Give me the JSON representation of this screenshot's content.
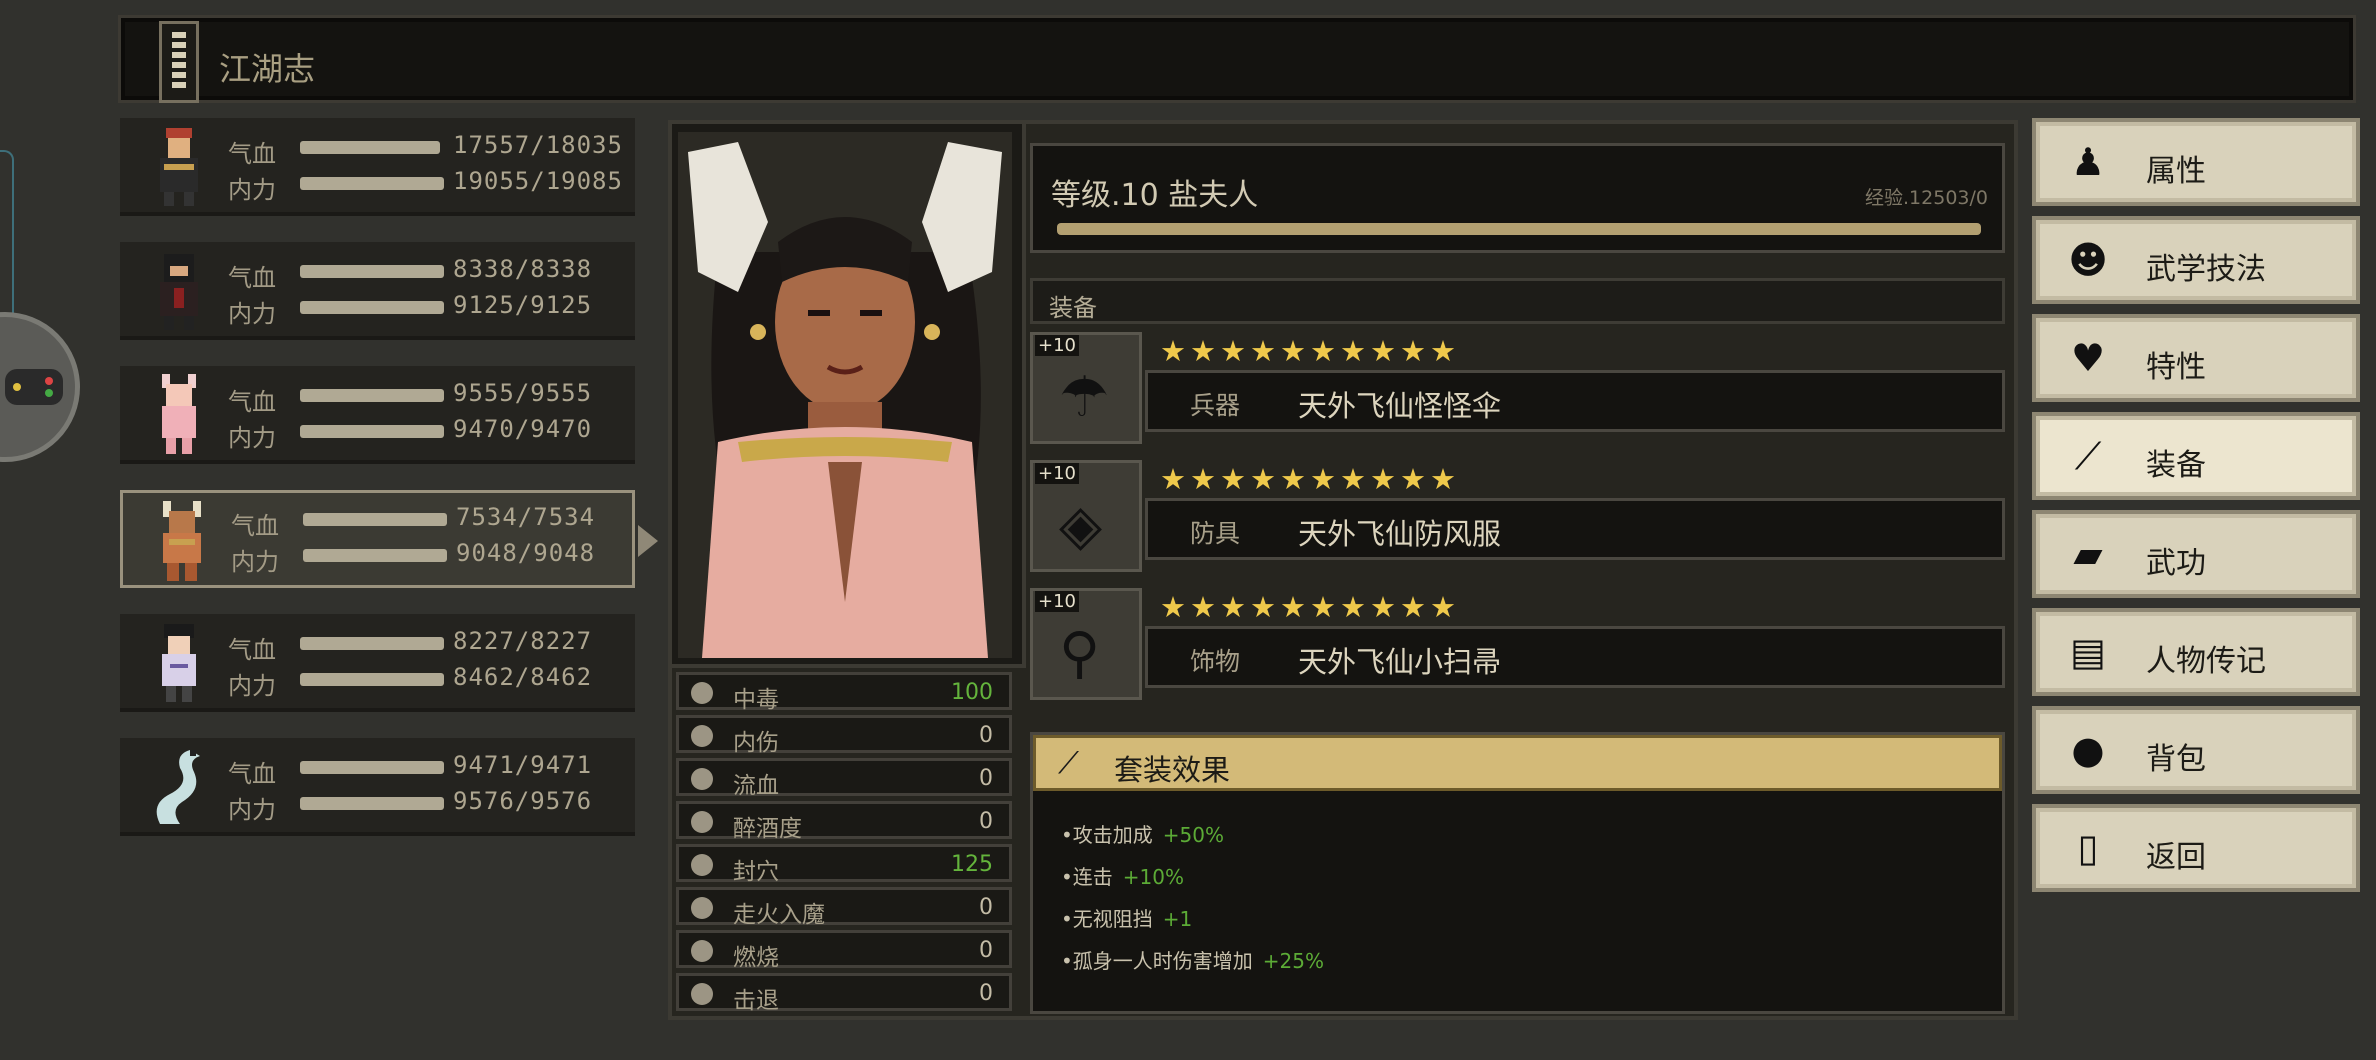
{
  "window": {
    "title": "江湖志"
  },
  "roster": [
    {
      "hp_label": "气血",
      "mp_label": "内力",
      "hp": "17557/18035",
      "mp": "19055/19085",
      "selected": false,
      "hp_fill": 0.97,
      "mp_fill": 1.0
    },
    {
      "hp_label": "气血",
      "mp_label": "内力",
      "hp": "8338/8338",
      "mp": "9125/9125",
      "selected": false,
      "hp_fill": 1.0,
      "mp_fill": 1.0
    },
    {
      "hp_label": "气血",
      "mp_label": "内力",
      "hp": "9555/9555",
      "mp": "9470/9470",
      "selected": false,
      "hp_fill": 1.0,
      "mp_fill": 1.0
    },
    {
      "hp_label": "气血",
      "mp_label": "内力",
      "hp": "7534/7534",
      "mp": "9048/9048",
      "selected": true,
      "hp_fill": 1.0,
      "mp_fill": 1.0
    },
    {
      "hp_label": "气血",
      "mp_label": "内力",
      "hp": "8227/8227",
      "mp": "8462/8462",
      "selected": false,
      "hp_fill": 1.0,
      "mp_fill": 1.0
    },
    {
      "hp_label": "气血",
      "mp_label": "内力",
      "hp": "9471/9471",
      "mp": "9576/9576",
      "selected": false,
      "hp_fill": 1.0,
      "mp_fill": 1.0
    }
  ],
  "character": {
    "level_line": "等级.10 盐夫人",
    "exp": "经验.12503/0"
  },
  "status": [
    {
      "label": "中毒",
      "value": "100",
      "highlight": true
    },
    {
      "label": "内伤",
      "value": "0",
      "highlight": false
    },
    {
      "label": "流血",
      "value": "0",
      "highlight": false
    },
    {
      "label": "醉酒度",
      "value": "0",
      "highlight": false
    },
    {
      "label": "封穴",
      "value": "125",
      "highlight": true
    },
    {
      "label": "走火入魔",
      "value": "0",
      "highlight": false
    },
    {
      "label": "燃烧",
      "value": "0",
      "highlight": false
    },
    {
      "label": "击退",
      "value": "0",
      "highlight": false
    }
  ],
  "equipment": {
    "header": "装备",
    "items": [
      {
        "plus": "+10",
        "type": "兵器",
        "name": "天外飞仙怪怪伞",
        "stars": 10,
        "icon": "umbrella-icon"
      },
      {
        "plus": "+10",
        "type": "防具",
        "name": "天外飞仙防风服",
        "stars": 10,
        "icon": "cloak-icon"
      },
      {
        "plus": "+10",
        "type": "饰物",
        "name": "天外飞仙小扫帚",
        "stars": 10,
        "icon": "broom-icon"
      }
    ]
  },
  "set_bonus": {
    "title": "套装效果",
    "effects": [
      {
        "text": "•攻击加成",
        "bonus": "+50%"
      },
      {
        "text": "•连击",
        "bonus": "+10%"
      },
      {
        "text": "•无视阻挡",
        "bonus": "+1"
      },
      {
        "text": "•孤身一人时伤害增加",
        "bonus": "+25%"
      }
    ]
  },
  "menu": [
    {
      "label": "属性",
      "icon": "person-icon",
      "active": false
    },
    {
      "label": "武学技法",
      "icon": "martial-arts-icon",
      "active": false
    },
    {
      "label": "特性",
      "icon": "trait-icon",
      "active": false
    },
    {
      "label": "装备",
      "icon": "sword-icon",
      "active": true
    },
    {
      "label": "武功",
      "icon": "book-icon",
      "active": false
    },
    {
      "label": "人物传记",
      "icon": "scroll-icon",
      "active": false
    },
    {
      "label": "背包",
      "icon": "bag-icon",
      "active": false
    },
    {
      "label": "返回",
      "icon": "door-icon",
      "active": false
    }
  ],
  "colors": {
    "accent_gold": "#d3ba78",
    "bonus_green": "#5cab36",
    "star": "#efc94b"
  }
}
